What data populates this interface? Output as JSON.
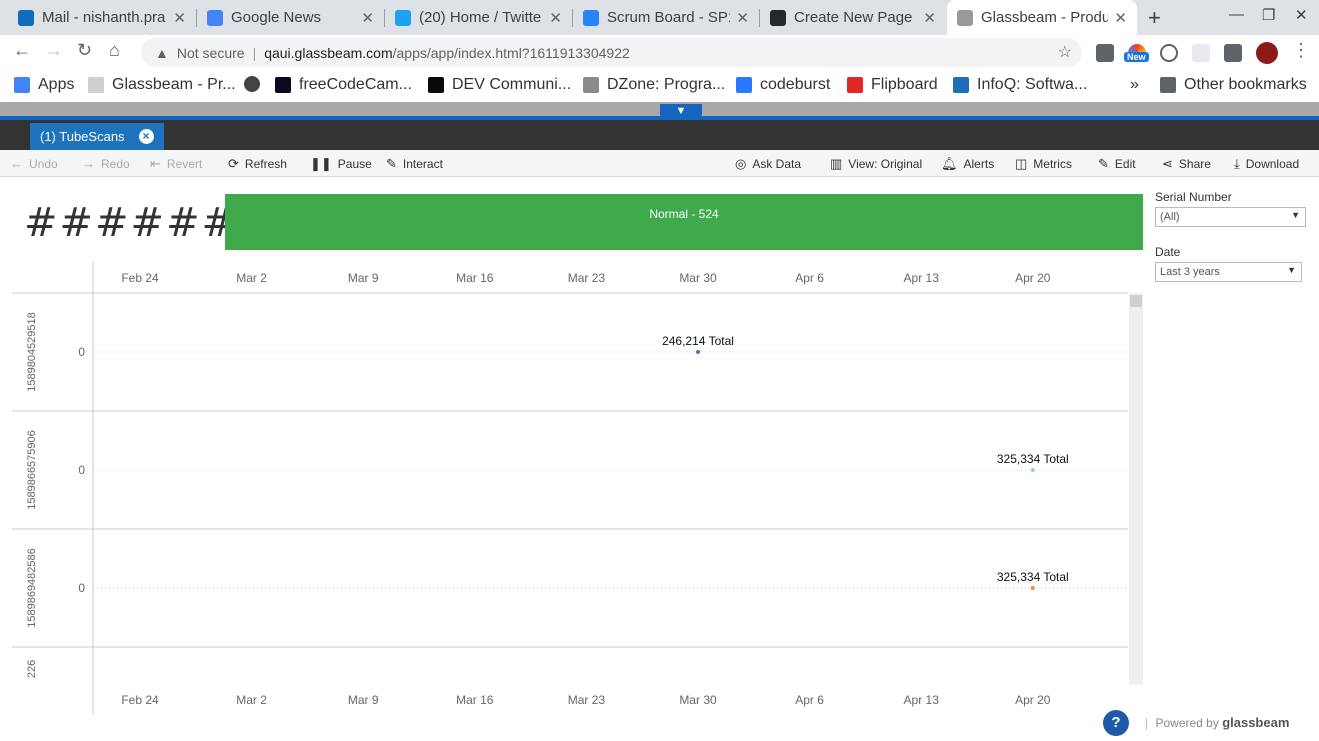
{
  "browser": {
    "tabs": [
      {
        "title": "Mail - nishanth.pra",
        "icon": "outlook-icon",
        "color": "#0f6cbd"
      },
      {
        "title": "Google News",
        "icon": "google-news-icon",
        "color": "#4285f4"
      },
      {
        "title": "(20) Home / Twitte",
        "icon": "twitter-icon",
        "color": "#1da1f2"
      },
      {
        "title": "Scrum Board - SP1",
        "icon": "jira-icon",
        "color": "#2684ff"
      },
      {
        "title": "Create New Page",
        "icon": "github-icon",
        "color": "#24292e"
      },
      {
        "title": "Glassbeam - Produ",
        "icon": "glassbeam-icon",
        "color": "#999999"
      }
    ],
    "address": {
      "security": "Not secure",
      "host": "qaui.glassbeam.com",
      "path": "/apps/app/index.html?1611913304922"
    },
    "extension_badge": "New",
    "bookmarks": [
      {
        "label": "Apps",
        "icon": "apps-grid-icon"
      },
      {
        "label": "Glassbeam - Pr...",
        "icon": "glassbeam-icon"
      },
      {
        "label": "",
        "icon": "globe-icon"
      },
      {
        "label": "freeCodeCam...",
        "icon": "freecodecamp-icon"
      },
      {
        "label": "DEV Communi...",
        "icon": "dev-icon"
      },
      {
        "label": "DZone: Progra...",
        "icon": "dzone-icon"
      },
      {
        "label": "codeburst",
        "icon": "codeburst-icon"
      },
      {
        "label": "Flipboard",
        "icon": "flipboard-icon"
      },
      {
        "label": "InfoQ: Softwa...",
        "icon": "infoq-icon"
      }
    ],
    "other_bookmarks": "Other bookmarks"
  },
  "app": {
    "view_tab": "(1) TubeScans",
    "toolbar": {
      "undo": "Undo",
      "redo": "Redo",
      "revert": "Revert",
      "refresh": "Refresh",
      "pause": "Pause",
      "interact": "Interact",
      "ask_data": "Ask Data",
      "view": "View: Original",
      "alerts": "Alerts",
      "metrics": "Metrics",
      "edit": "Edit",
      "share": "Share",
      "download": "Download"
    },
    "kpi_text": "#######",
    "status_bar": "Normal - 524",
    "status_color": "#3fa94c",
    "filters": {
      "serial_label": "Serial Number",
      "serial_value": "(All)",
      "date_label": "Date",
      "date_value": "Last 3 years"
    },
    "powered_by": "Powered by",
    "brand": "glassbeam",
    "help": "?"
  },
  "chart_data": {
    "type": "scatter",
    "x_ticks": [
      "Feb 24",
      "Mar 2",
      "Mar 9",
      "Mar 16",
      "Mar 23",
      "Mar 30",
      "Apr 6",
      "Apr 13",
      "Apr 20"
    ],
    "rows": [
      {
        "label": "1589804529518",
        "zero": "0",
        "point_date": "Mar 30",
        "annotation": "246,214 Total",
        "color": "#4e79a7"
      },
      {
        "label": "1589866575906",
        "zero": "0",
        "point_date": "Apr 20",
        "annotation": "325,334 Total",
        "color": "#a0cbe8"
      },
      {
        "label": "1589869482586",
        "zero": "0",
        "point_date": "Apr 20",
        "annotation": "325,334 Total",
        "color": "#f28e2b"
      },
      {
        "label": "226",
        "zero": "",
        "point_date": "",
        "annotation": "",
        "color": ""
      }
    ]
  }
}
